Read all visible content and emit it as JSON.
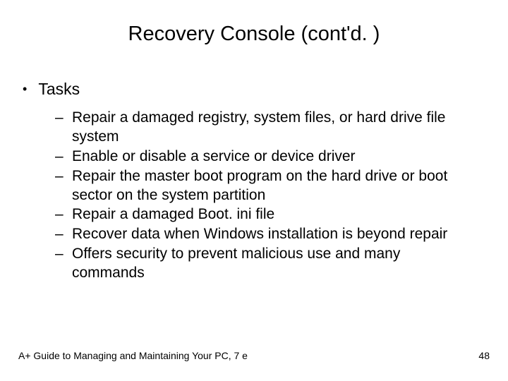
{
  "title": "Recovery Console (cont'd. )",
  "top_bullet": "Tasks",
  "sub_bullets": [
    "Repair a damaged registry, system files, or hard drive file system",
    "Enable or disable a service or device driver",
    "Repair the master boot program on the hard drive or boot sector on the system partition",
    "Repair a damaged Boot. ini file",
    "Recover data when Windows installation is beyond repair",
    "Offers security to prevent malicious use and many commands"
  ],
  "footer_left": "A+ Guide to Managing and Maintaining Your PC, 7 e",
  "footer_right": "48"
}
